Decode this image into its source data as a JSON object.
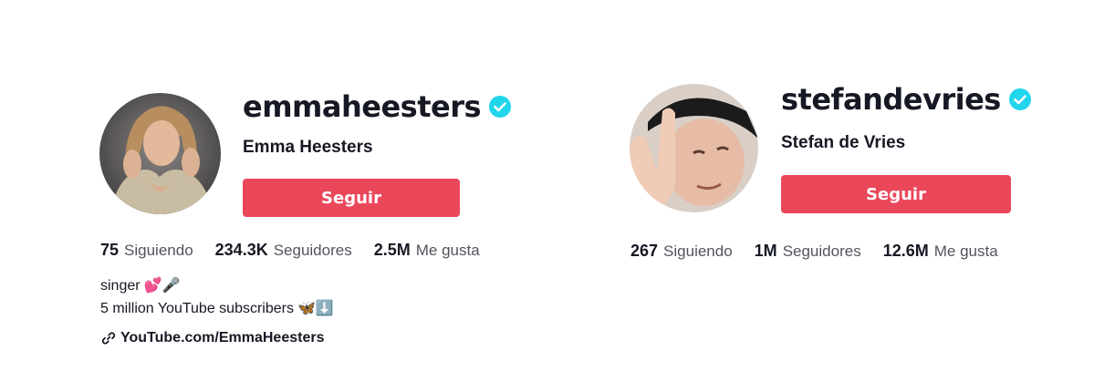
{
  "colors": {
    "accent": "#FE2C55",
    "button": "#EA475A",
    "verified": "#20D5EC",
    "text": "#161823",
    "secondary": "#5B5C63"
  },
  "profiles": [
    {
      "username": "emmaheesters",
      "verified_icon": "verified-check-icon",
      "display_name": "Emma Heesters",
      "follow_label": "Seguir",
      "stats": {
        "following": {
          "value": "75",
          "label": "Siguiendo"
        },
        "followers": {
          "value": "234.3K",
          "label": "Seguidores"
        },
        "likes": {
          "value": "2.5M",
          "label": "Me gusta"
        }
      },
      "bio": {
        "line1": "singer",
        "line1_emoji": "💕🎤",
        "line2": "5 million YouTube subscribers",
        "line2_emoji": "🦋⬇️"
      },
      "link": {
        "icon": "link-icon",
        "text": "YouTube.com/EmmaHeesters"
      }
    },
    {
      "username": "stefandevries",
      "verified_icon": "verified-check-icon",
      "display_name": "Stefan de Vries",
      "follow_label": "Seguir",
      "stats": {
        "following": {
          "value": "267",
          "label": "Siguiendo"
        },
        "followers": {
          "value": "1M",
          "label": "Seguidores"
        },
        "likes": {
          "value": "12.6M",
          "label": "Me gusta"
        }
      }
    }
  ]
}
